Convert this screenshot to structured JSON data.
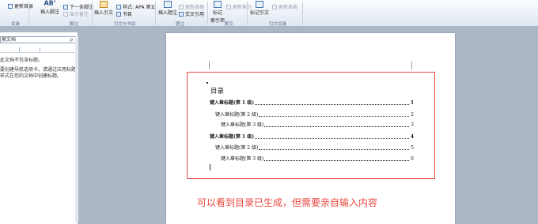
{
  "ribbon": {
    "update_toc": "更新目录",
    "insert_footnote": "插入脚注",
    "ab_label": "AB",
    "ab_sup": "1",
    "next_footnote": "下一条脚注",
    "show_notes": "显示备注",
    "insert_citation": "插入引文",
    "style_label": "样式:",
    "style_value": "APA 第五",
    "bibliography": "书目",
    "insert_caption": "插入题注",
    "update_table": "更新表格",
    "cross_reference": "交叉引用",
    "mark_entry": "标记",
    "index_label": "索引项",
    "update_index": "更新索引",
    "mark_citation": "标记引文",
    "update_table_auth": "更新表格",
    "groups": {
      "toc": "目录",
      "footnotes": "脚注",
      "citations": "引文与书目",
      "captions": "题注",
      "index": "索引",
      "table_of_auth": "引文目录"
    }
  },
  "nav": {
    "search_placeholder": "索文档",
    "search_icon_glyph": "ρ",
    "message1": "此文档不包含标题。",
    "message2": "要创建导航选项卡，请通过应用标题样式在您的文档中创建标题。"
  },
  "document": {
    "toc_title": "目录",
    "entries": [
      {
        "label": "键入章标题(第 1 级)",
        "page": "1",
        "level": 1
      },
      {
        "label": "键入章标题(第 2 级)",
        "page": "2",
        "level": 2
      },
      {
        "label": "键入章标题(第 3 级)",
        "page": "3",
        "level": 3
      },
      {
        "label": "键入章标题(第 1 级)",
        "page": "4",
        "level": 1
      },
      {
        "label": "键入章标题(第 2 级)",
        "page": "5",
        "level": 2
      },
      {
        "label": "键入章标题(第 3 级)",
        "page": "6",
        "level": 3
      }
    ]
  },
  "annotation": "可以看到目录已生成，但需要亲自输入内容",
  "colors": {
    "annotation_red": "#e8473e",
    "workspace": "#abb7c6"
  }
}
